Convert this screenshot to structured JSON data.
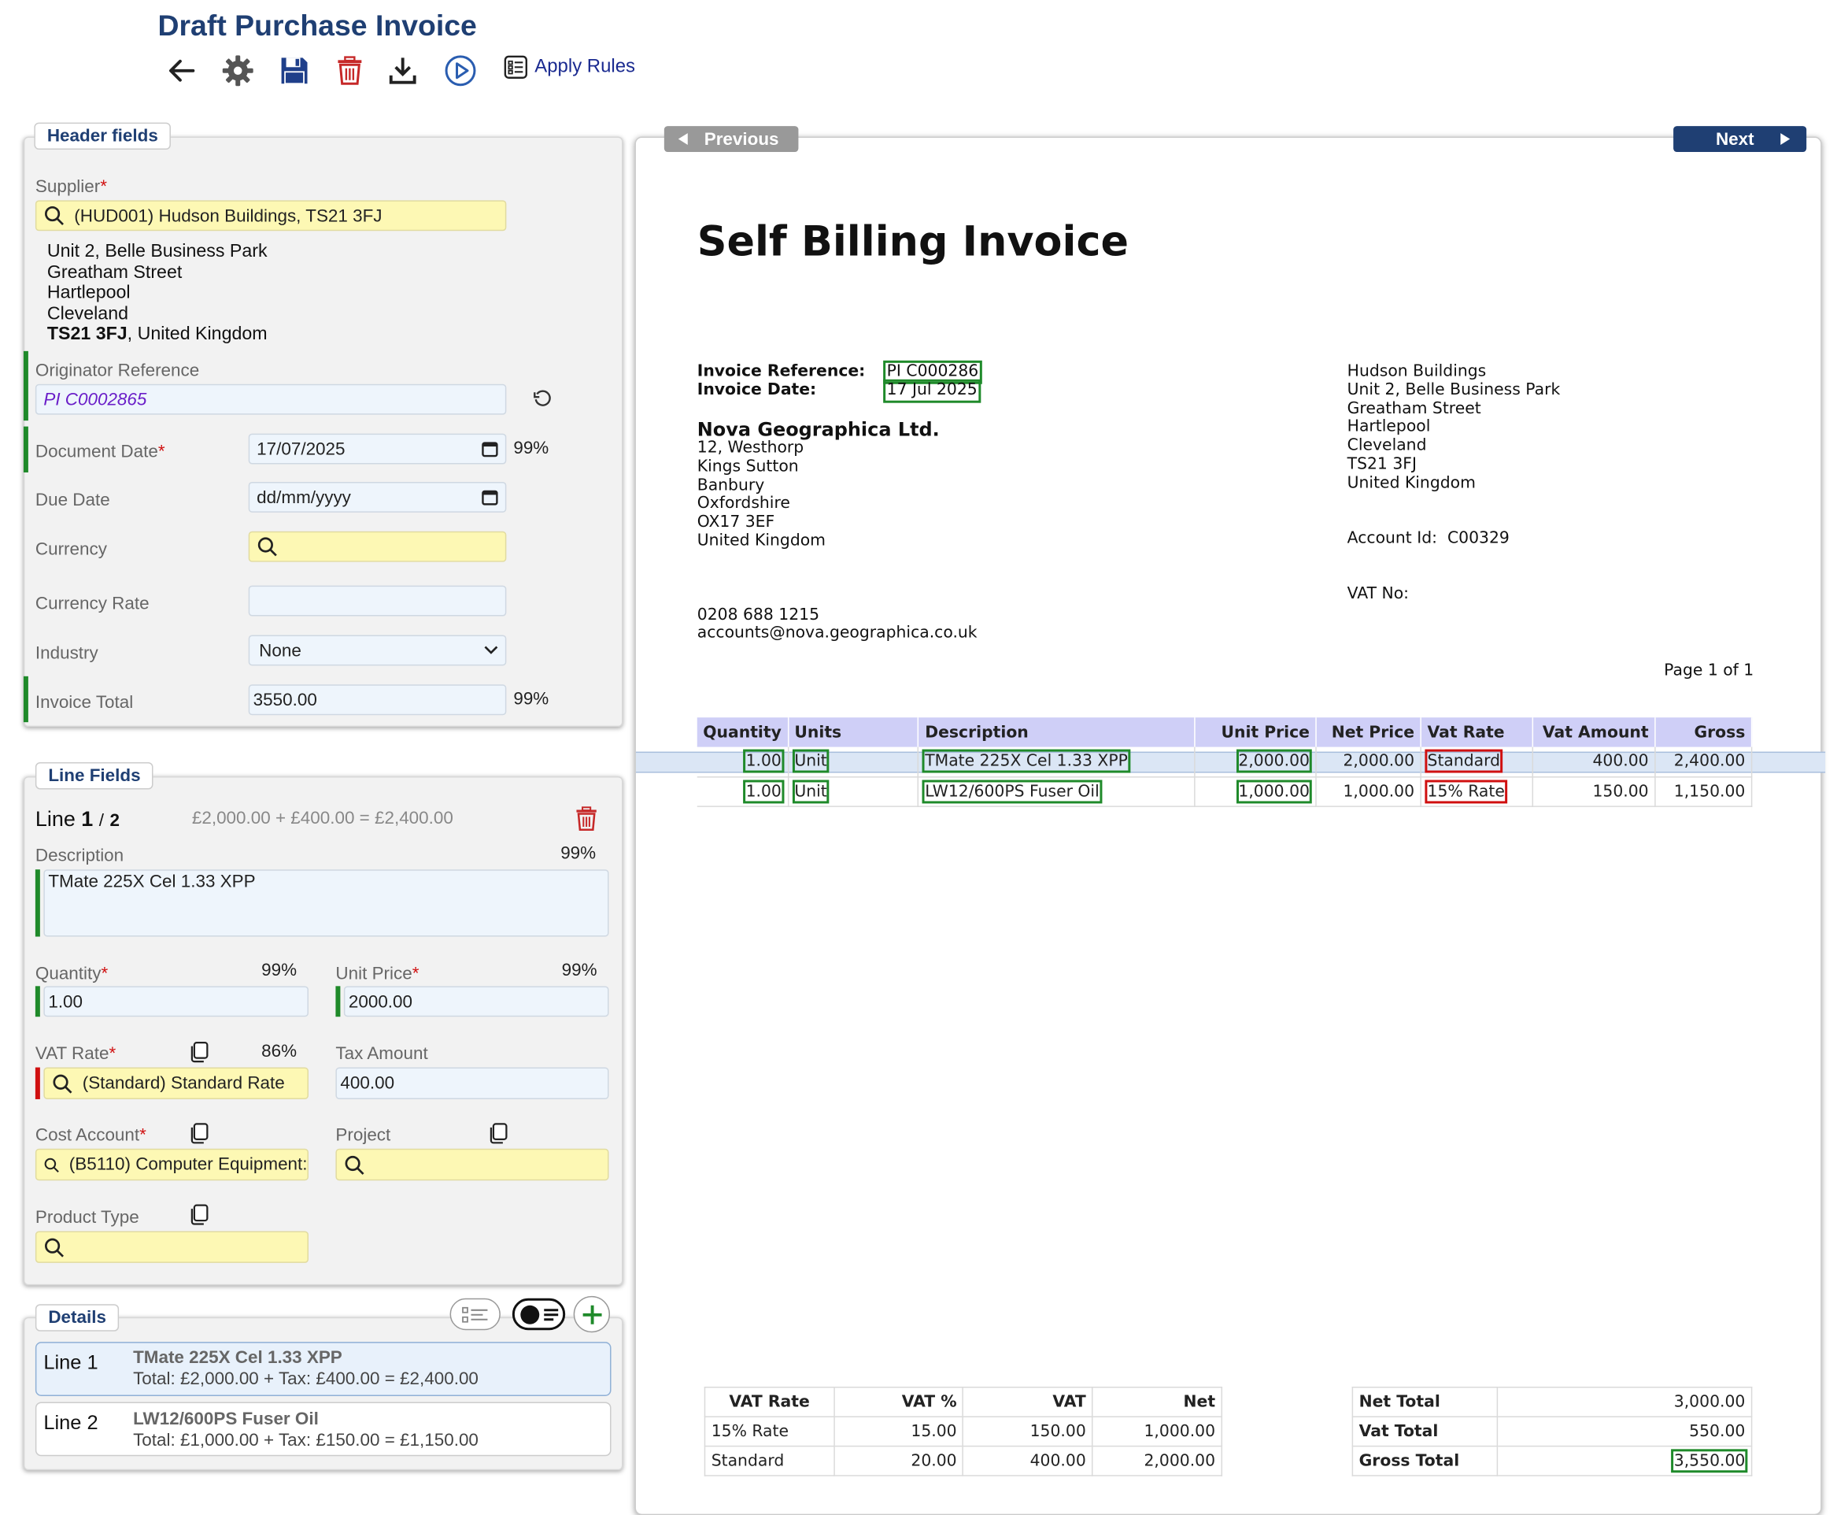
{
  "page": {
    "title": "Draft Purchase Invoice",
    "toolbar": {
      "apply_rules": "Apply Rules"
    }
  },
  "header_fields": {
    "legend": "Header fields",
    "supplier": {
      "label": "Supplier",
      "value": "(HUD001) Hudson Buildings, TS21 3FJ",
      "address_lines": [
        "Unit 2, Belle Business Park",
        "Greatham Street",
        "Hartlepool",
        "Cleveland"
      ],
      "postcode": "TS21 3FJ",
      "country_suffix": ", United Kingdom"
    },
    "originator_reference": {
      "label": "Originator Reference",
      "value": "PI C0002865"
    },
    "document_date": {
      "label": "Document Date",
      "value": "17/07/2025",
      "confidence": "99%"
    },
    "due_date": {
      "label": "Due Date",
      "placeholder": "dd/mm/yyyy"
    },
    "currency": {
      "label": "Currency",
      "value": ""
    },
    "currency_rate": {
      "label": "Currency Rate",
      "value": ""
    },
    "industry": {
      "label": "Industry",
      "value": "None"
    },
    "invoice_total": {
      "label": "Invoice Total",
      "value": "3550.00",
      "confidence": "99%"
    }
  },
  "line_fields": {
    "legend": "Line Fields",
    "line_word": "Line",
    "line_index": "1",
    "line_sep": "/",
    "line_count": "2",
    "calc": "£2,000.00 + £400.00 = £2,400.00",
    "description": {
      "label": "Description",
      "value": "TMate 225X Cel 1.33 XPP",
      "confidence": "99%"
    },
    "quantity": {
      "label": "Quantity",
      "value": "1.00",
      "confidence": "99%"
    },
    "unit_price": {
      "label": "Unit Price",
      "value": "2000.00",
      "confidence": "99%"
    },
    "vat_rate": {
      "label": "VAT Rate",
      "value": "(Standard) Standard Rate",
      "confidence": "86%"
    },
    "tax_amount": {
      "label": "Tax Amount",
      "value": "400.00"
    },
    "cost_account": {
      "label": "Cost Account",
      "value": "(B5110) Computer Equipment:"
    },
    "project": {
      "label": "Project",
      "value": ""
    },
    "product_type": {
      "label": "Product Type",
      "value": ""
    }
  },
  "details": {
    "legend": "Details",
    "items": [
      {
        "line": "Line 1",
        "desc": "TMate 225X Cel 1.33 XPP",
        "total": "Total: £2,000.00 + Tax: £400.00 = £2,400.00"
      },
      {
        "line": "Line 2",
        "desc": "LW12/600PS Fuser Oil",
        "total": "Total: £1,000.00 + Tax: £150.00 = £1,150.00"
      }
    ]
  },
  "viewer": {
    "previous": "Previous",
    "next": "Next"
  },
  "document": {
    "title": "Self Billing Invoice",
    "ref_label": "Invoice Reference:",
    "ref_value": "PI C000286",
    "date_label": "Invoice Date:",
    "date_value": "17 Jul 2025",
    "company": "Nova Geographica Ltd.",
    "company_address": [
      "12, Westhorp",
      "Kings Sutton",
      "Banbury",
      "Oxfordshire",
      "OX17 3EF",
      "United Kingdom"
    ],
    "phone": "0208 688 1215",
    "email": "accounts@nova.geographica.co.uk",
    "supplier_address": [
      "Hudson Buildings",
      "Unit 2, Belle Business Park",
      "Greatham Street",
      "Hartlepool",
      "Cleveland",
      "TS21 3FJ",
      "United Kingdom"
    ],
    "account_label": "Account Id:",
    "account_value": "C00329",
    "vat_no_label": "VAT No:",
    "page_of": "Page 1 of 1",
    "columns": [
      "Quantity",
      "Units",
      "Description",
      "Unit Price",
      "Net Price",
      "Vat Rate",
      "Vat Amount",
      "Gross"
    ],
    "rows": [
      {
        "qty": "1.00",
        "unit": "Unit",
        "desc": "TMate 225X Cel 1.33 XPP",
        "unit_price": "2,000.00",
        "net": "2,000.00",
        "vat_rate": "Standard",
        "vat_amount": "400.00",
        "gross": "2,400.00"
      },
      {
        "qty": "1.00",
        "unit": "Unit",
        "desc": "LW12/600PS Fuser Oil",
        "unit_price": "1,000.00",
        "net": "1,000.00",
        "vat_rate": "15% Rate",
        "vat_amount": "150.00",
        "gross": "1,150.00"
      }
    ],
    "vat_summary": {
      "headers": [
        "VAT Rate",
        "VAT %",
        "VAT",
        "Net"
      ],
      "rows": [
        [
          "15% Rate",
          "15.00",
          "150.00",
          "1,000.00"
        ],
        [
          "Standard",
          "20.00",
          "400.00",
          "2,000.00"
        ]
      ]
    },
    "totals": {
      "net_label": "Net Total",
      "net_value": "3,000.00",
      "vat_label": "Vat Total",
      "vat_value": "550.00",
      "gross_label": "Gross Total",
      "gross_value": "3,550.00"
    }
  },
  "colors": {
    "title": "#1f3f73",
    "required": "#d01010",
    "match": "#1f8a2a",
    "mismatch": "#d01010",
    "highlight_field": "#fdf8b4"
  }
}
